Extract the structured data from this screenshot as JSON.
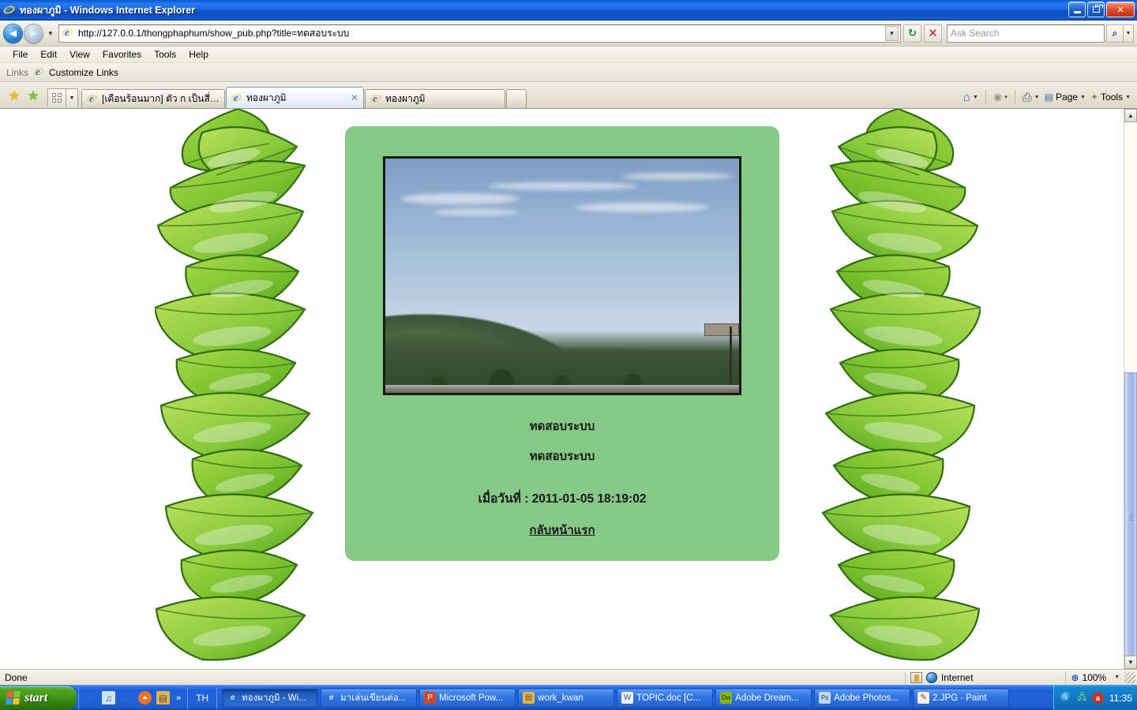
{
  "window": {
    "title": "ทองผาภูมิ - Windows Internet Explorer",
    "icon": "ie-icon",
    "minimize_label": "_",
    "restore_label": "restore",
    "close_label": "✕"
  },
  "address_bar": {
    "back_label": "◄",
    "forward_label": "►",
    "history_caret": "▼",
    "url": "http://127.0.0.1/thongphaphum/show_pub.php?title=ทดสอบระบบ",
    "url_dropdown": "▼",
    "refresh_label": "↻",
    "stop_label": "✕",
    "search_placeholder": "Ask Search",
    "search_value": "",
    "search_go": "⌕",
    "search_caret": "▼"
  },
  "menu": {
    "items": [
      "File",
      "Edit",
      "View",
      "Favorites",
      "Tools",
      "Help"
    ]
  },
  "links_bar": {
    "label": "Links",
    "item": "Customize Links"
  },
  "tabs": {
    "favorites_star": "★",
    "add_favorites_star": "★",
    "quicktabs_caret": "▼",
    "list": [
      {
        "label": "[เดือนร้อนมาก] ตัว ก เป็นสี่เห...",
        "active": false,
        "closable": false
      },
      {
        "label": "ทองผาภูมิ",
        "active": true,
        "closable": true,
        "close_label": "✕"
      },
      {
        "label": "ทองผาภูมิ",
        "active": false,
        "closable": false
      }
    ],
    "toolbar_right": [
      {
        "name": "home-icon",
        "label": "",
        "glyph": "⌂",
        "caret": "▼"
      },
      {
        "name": "feeds-icon",
        "label": "",
        "glyph": "◉",
        "caret": "▾"
      },
      {
        "name": "print-icon",
        "label": "",
        "glyph": "⎙",
        "caret": "▼"
      },
      {
        "name": "page-menu",
        "label": "Page",
        "glyph": "▤",
        "caret": "▼"
      },
      {
        "name": "tools-menu",
        "label": "Tools",
        "glyph": "✦",
        "caret": "▼"
      }
    ],
    "overflow": "»"
  },
  "page": {
    "card_color": "#84c984",
    "photo_alt": "mountain-landscape-photo",
    "caption_1": "ทดสอบระบบ",
    "caption_2": "ทดสอบระบบ",
    "date_line": "เมื่อวันที่ : 2011-01-05 18:19:02",
    "back_link": "กลับหน้าแรก"
  },
  "scrollbar": {
    "up_label": "▲",
    "down_label": "▼"
  },
  "status_bar": {
    "status": "Done",
    "zone": "Internet",
    "zoom": "100%",
    "zoom_caret": "▼"
  },
  "taskbar": {
    "start_label": "start",
    "quick_launch": [
      {
        "name": "ie-quicklaunch-icon",
        "glyph": "e",
        "color": "#1f6fd0"
      },
      {
        "name": "media-quicklaunch-icon",
        "glyph": "♫",
        "color": "#d8e6f5"
      },
      {
        "name": "ie2-quicklaunch-icon",
        "glyph": "e",
        "color": "#1f6fd0"
      },
      {
        "name": "firefox-quicklaunch-icon",
        "glyph": "◓",
        "color": "#e8742a"
      },
      {
        "name": "folder-quicklaunch-icon",
        "glyph": "▤",
        "color": "#dcb55c"
      }
    ],
    "quick_launch_more": "»",
    "language": "TH",
    "buttons": [
      {
        "label": "ทองผาภูมิ - Wi...",
        "icon": "ie-icon",
        "pressed": true
      },
      {
        "label": "มาเล่นเขียนต่อ...",
        "icon": "ie-icon",
        "pressed": false
      },
      {
        "label": "Microsoft Pow...",
        "icon": "powerpoint-icon",
        "pressed": false
      },
      {
        "label": "work_kwan",
        "icon": "folder-icon",
        "pressed": false
      },
      {
        "label": "TOPIC.doc [C...",
        "icon": "word-icon",
        "pressed": false
      },
      {
        "label": "Adobe Dream...",
        "icon": "dreamweaver-icon",
        "pressed": false
      },
      {
        "label": "Adobe Photos...",
        "icon": "photoshop-icon",
        "pressed": false
      },
      {
        "label": "2.JPG - Paint",
        "icon": "paint-icon",
        "pressed": false
      }
    ],
    "tray_arrow": "‹",
    "tray_icons": [
      {
        "name": "network-tray-icon",
        "glyph": "🖧"
      },
      {
        "name": "antivirus-tray-icon",
        "glyph": "a"
      }
    ],
    "clock": "11:35"
  }
}
